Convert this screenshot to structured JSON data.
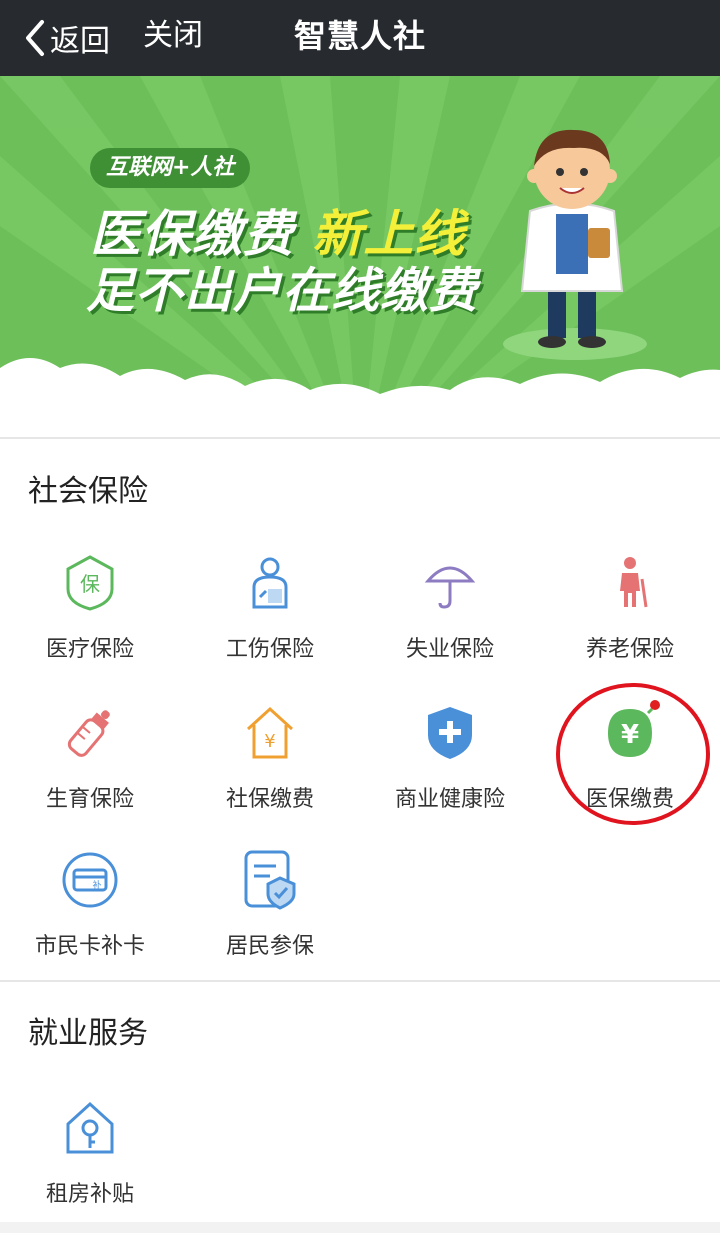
{
  "topbar": {
    "back_label": "返回",
    "close_label": "关闭",
    "title": "智慧人社"
  },
  "banner": {
    "tag": "互联网+人社",
    "line1_part1": "医保缴费",
    "line1_part2": "新上线",
    "line2": "足不出户在线缴费"
  },
  "sections": {
    "social_insurance": {
      "title": "社会保险",
      "items": [
        {
          "label": "医疗保险",
          "icon": "medical-shield-icon",
          "color": "#5cb85c"
        },
        {
          "label": "工伤保险",
          "icon": "injury-person-icon",
          "color": "#4a90d9"
        },
        {
          "label": "失业保险",
          "icon": "umbrella-icon",
          "color": "#8e7cc3"
        },
        {
          "label": "养老保险",
          "icon": "elderly-person-icon",
          "color": "#e57373"
        },
        {
          "label": "生育保险",
          "icon": "baby-bottle-icon",
          "color": "#e57373"
        },
        {
          "label": "社保缴费",
          "icon": "house-yuan-icon",
          "color": "#f0a030"
        },
        {
          "label": "商业健康险",
          "icon": "health-shield-icon",
          "color": "#4a90d9"
        },
        {
          "label": "医保缴费",
          "icon": "yuan-leaf-icon",
          "color": "#5cb85c"
        },
        {
          "label": "市民卡补卡",
          "icon": "card-reissue-icon",
          "color": "#4a90d9"
        },
        {
          "label": "居民参保",
          "icon": "document-shield-icon",
          "color": "#4a90d9"
        }
      ]
    },
    "employment": {
      "title": "就业服务",
      "items": [
        {
          "label": "租房补贴",
          "icon": "house-key-icon",
          "color": "#4a90d9"
        }
      ]
    }
  }
}
